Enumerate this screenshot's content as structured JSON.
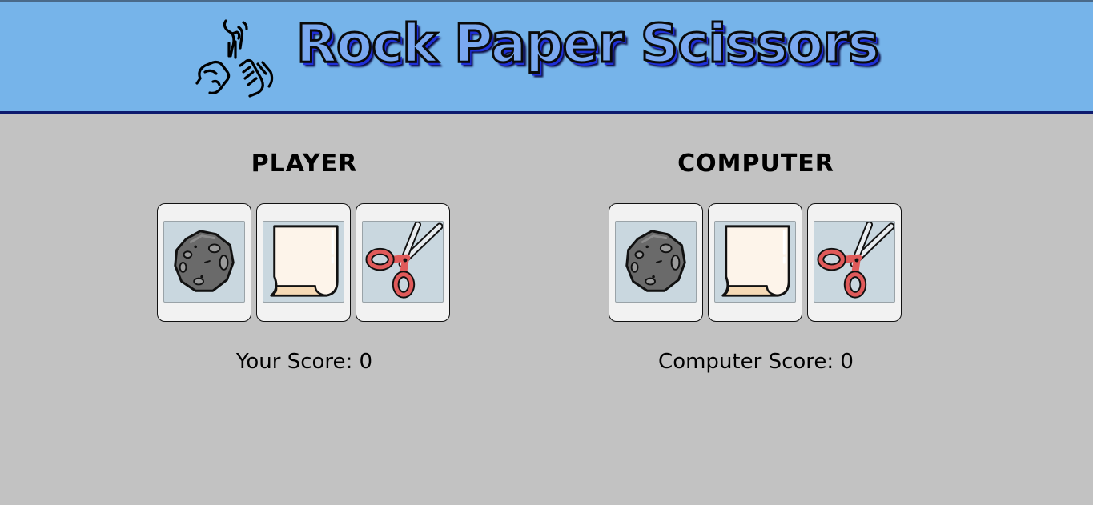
{
  "header": {
    "title": "Rock Paper Scissors",
    "logo_icon": "hands-rock-paper-scissors-icon"
  },
  "player": {
    "heading": "PLAYER",
    "score_label": "Your Score: 0",
    "choices": [
      {
        "name": "rock",
        "icon": "rock-icon"
      },
      {
        "name": "paper",
        "icon": "paper-icon"
      },
      {
        "name": "scissors",
        "icon": "scissors-icon"
      }
    ]
  },
  "computer": {
    "heading": "COMPUTER",
    "score_label": "Computer Score: 0",
    "choices": [
      {
        "name": "rock",
        "icon": "rock-icon"
      },
      {
        "name": "paper",
        "icon": "paper-icon"
      },
      {
        "name": "scissors",
        "icon": "scissors-icon"
      }
    ]
  },
  "colors": {
    "header_bg": "#76b4ea",
    "page_bg": "#c2c2c2",
    "card_bg": "#f2f2f2",
    "icon_bg": "#c9d7df",
    "title_fill": "#7aa8f0",
    "title_shadow": "#1f2fd6",
    "scissors_handle": "#e05a5a"
  }
}
